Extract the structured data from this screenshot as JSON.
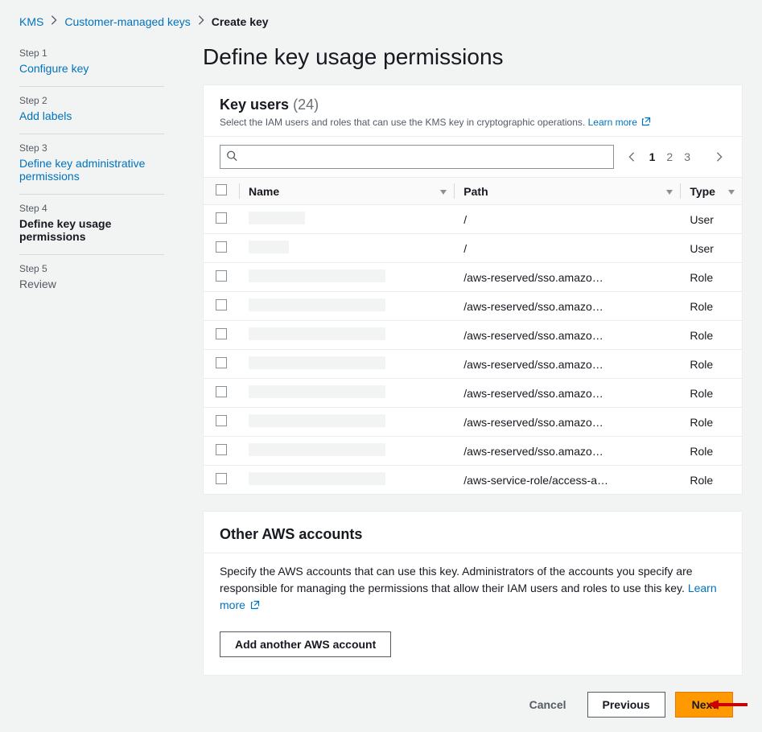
{
  "breadcrumb": {
    "root": "KMS",
    "mid": "Customer-managed keys",
    "current": "Create key"
  },
  "steps": [
    {
      "label": "Step 1",
      "title": "Configure key",
      "state": "done"
    },
    {
      "label": "Step 2",
      "title": "Add labels",
      "state": "done"
    },
    {
      "label": "Step 3",
      "title": "Define key administrative permissions",
      "state": "done"
    },
    {
      "label": "Step 4",
      "title": "Define key usage permissions",
      "state": "active"
    },
    {
      "label": "Step 5",
      "title": "Review",
      "state": "future"
    }
  ],
  "page_title": "Define key usage permissions",
  "key_users": {
    "title": "Key users",
    "count": "(24)",
    "subtitle": "Select the IAM users and roles that can use the KMS key in cryptographic operations.",
    "learn_more": "Learn more",
    "search_placeholder": "",
    "pages": [
      "1",
      "2",
      "3"
    ],
    "current_page": "1",
    "columns": {
      "name": "Name",
      "path": "Path",
      "type": "Type"
    },
    "rows": [
      {
        "redacted": "w1",
        "path": "/",
        "type": "User"
      },
      {
        "redacted": "w2",
        "path": "/",
        "type": "User"
      },
      {
        "redacted": "w3",
        "path": "/aws-reserved/sso.amazonaws…",
        "type": "Role"
      },
      {
        "redacted": "w3",
        "path": "/aws-reserved/sso.amazonaws…",
        "type": "Role"
      },
      {
        "redacted": "w3",
        "path": "/aws-reserved/sso.amazonaws…",
        "type": "Role"
      },
      {
        "redacted": "w3",
        "path": "/aws-reserved/sso.amazonaws…",
        "type": "Role"
      },
      {
        "redacted": "w3",
        "path": "/aws-reserved/sso.amazonaws…",
        "type": "Role"
      },
      {
        "redacted": "w3",
        "path": "/aws-reserved/sso.amazonaws…",
        "type": "Role"
      },
      {
        "redacted": "w3",
        "path": "/aws-reserved/sso.amazonaws…",
        "type": "Role"
      },
      {
        "redacted": "w3",
        "path": "/aws-service-role/access-analy…",
        "type": "Role"
      }
    ]
  },
  "other_accounts": {
    "title": "Other AWS accounts",
    "desc": "Specify the AWS accounts that can use this key. Administrators of the accounts you specify are responsible for managing the permissions that allow their IAM users and roles to use this key.",
    "learn_more": "Learn more",
    "add_button": "Add another AWS account"
  },
  "footer": {
    "cancel": "Cancel",
    "previous": "Previous",
    "next": "Next"
  }
}
